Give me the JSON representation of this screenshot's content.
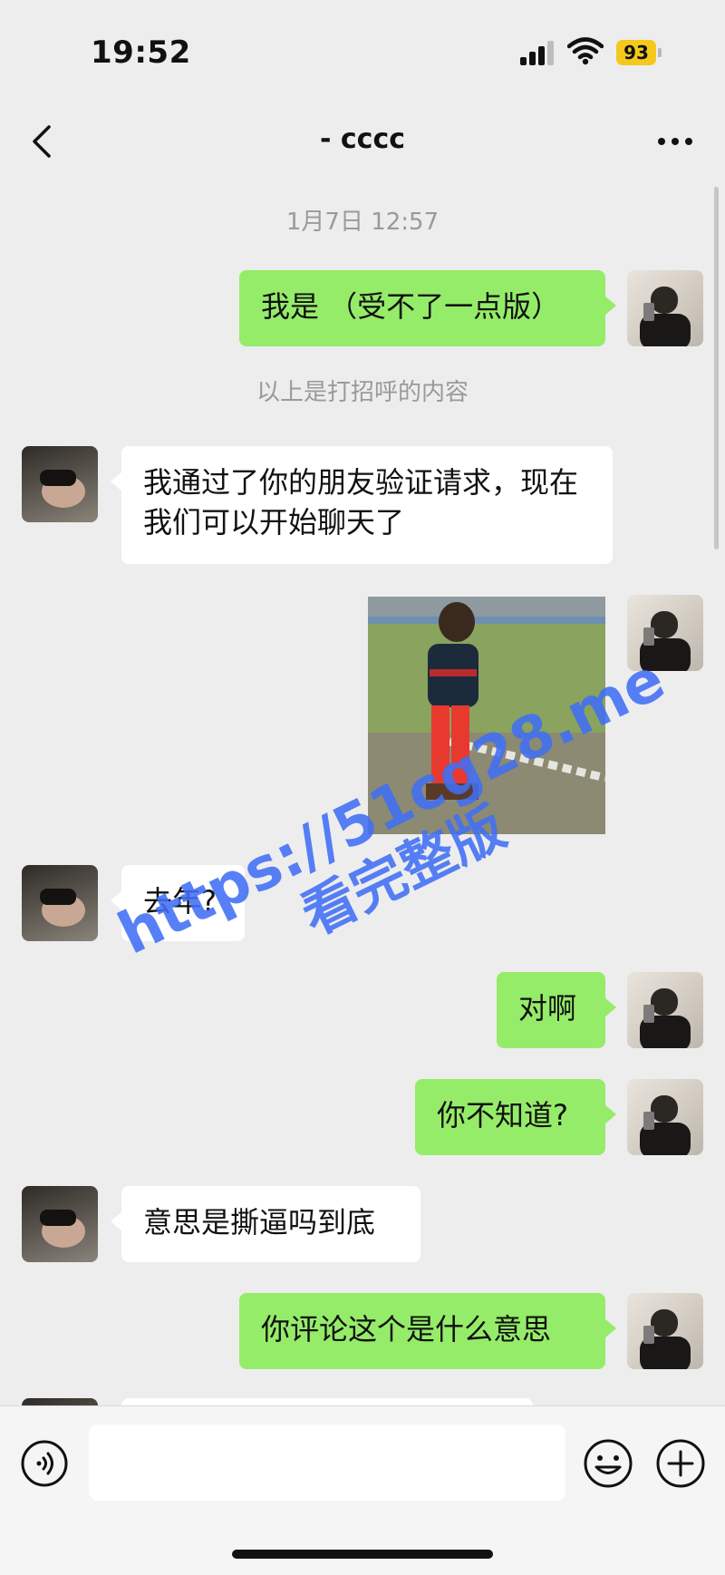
{
  "status_bar": {
    "time": "19:52",
    "battery": "93",
    "battery_color": "#f4c91c"
  },
  "header": {
    "title": "- cccc",
    "back_icon": "chevron-left-icon",
    "more_icon": "more-dots-icon"
  },
  "messages": [
    {
      "type": "timestamp",
      "text": "1月7日 12:57"
    },
    {
      "type": "text",
      "from": "self",
      "text": "我是 （受不了一点版）"
    },
    {
      "type": "system",
      "text": "以上是打招呼的内容"
    },
    {
      "type": "text",
      "from": "friend",
      "text": "我通过了你的朋友验证请求，现在我们可以开始聊天了"
    },
    {
      "type": "image",
      "from": "self"
    },
    {
      "type": "text",
      "from": "friend",
      "text": "去年?"
    },
    {
      "type": "text",
      "from": "self",
      "text": "对啊"
    },
    {
      "type": "text",
      "from": "self",
      "text": "你不知道?"
    },
    {
      "type": "text",
      "from": "friend",
      "text": "意思是撕逼吗到底"
    },
    {
      "type": "text",
      "from": "self",
      "text": "你评论这个是什么意思"
    }
  ],
  "watermark": {
    "line1": "https://51cg28.me",
    "line2": "看完整版",
    "color": "#406ef5"
  },
  "input_bar": {
    "voice_icon": "voice-icon",
    "emoji_icon": "emoji-icon",
    "plus_icon": "plus-icon",
    "placeholder": ""
  },
  "colors": {
    "outgoing_bubble": "#95ec69",
    "incoming_bubble": "#ffffff",
    "background": "#ededed"
  }
}
